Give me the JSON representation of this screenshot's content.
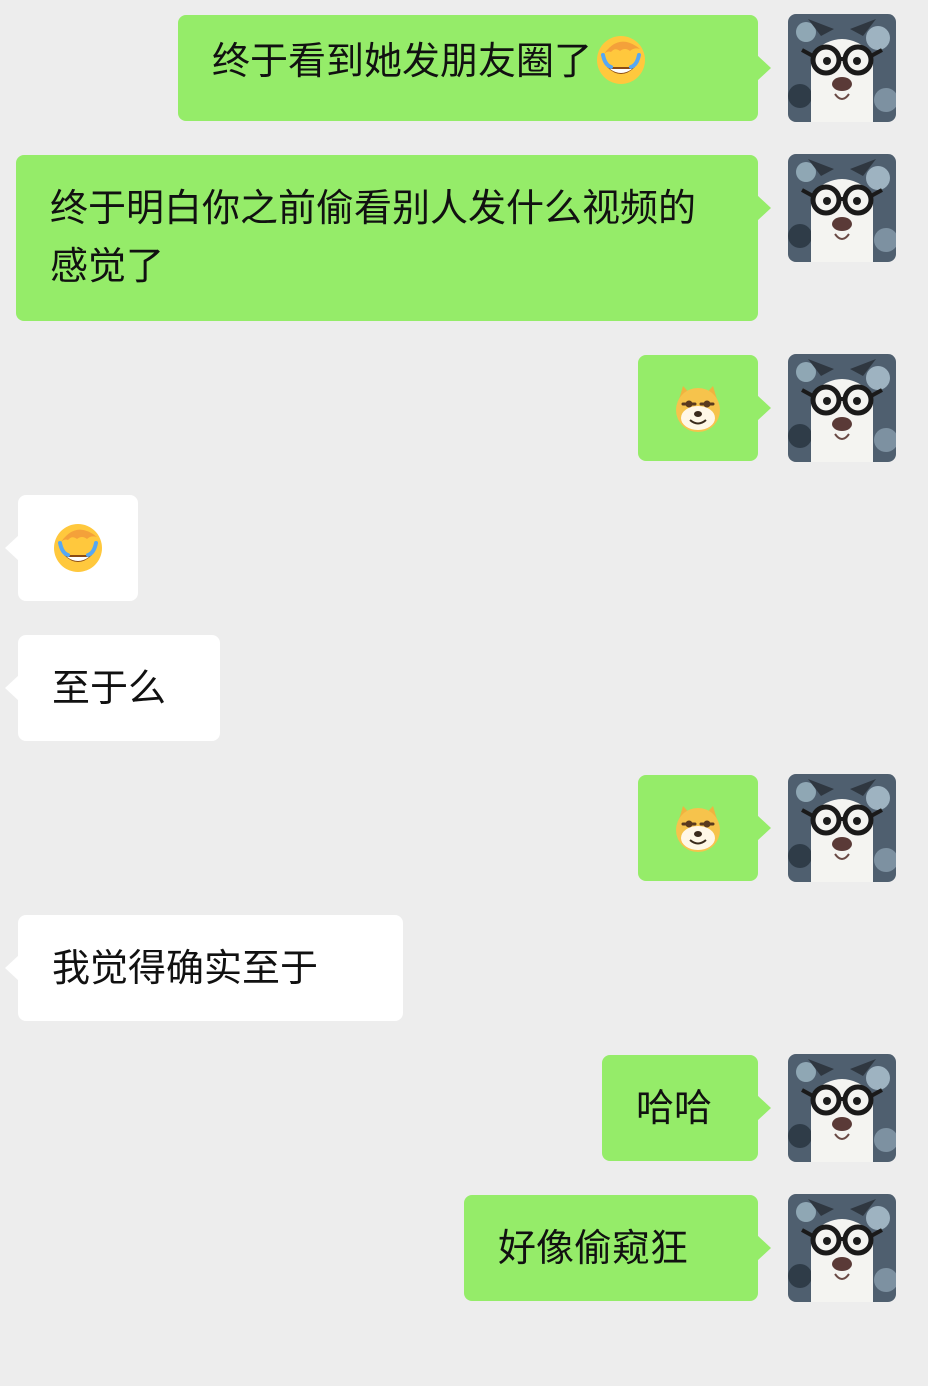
{
  "chat": {
    "messages": [
      {
        "id": "m1",
        "side": "sent",
        "text": "终于看到她发朋友圈了",
        "emoji": "facepalm-laugh-emoji"
      },
      {
        "id": "m2",
        "side": "sent",
        "text": "终于明白你之前偷看别人发什么视频的感觉了"
      },
      {
        "id": "m3",
        "side": "sent",
        "emoji": "doge-emoji"
      },
      {
        "id": "m4",
        "side": "received",
        "emoji": "facepalm-laugh-emoji"
      },
      {
        "id": "m5",
        "side": "received",
        "text": "至于么"
      },
      {
        "id": "m6",
        "side": "sent",
        "emoji": "doge-emoji"
      },
      {
        "id": "m7",
        "side": "received",
        "text": "我觉得确实至于"
      },
      {
        "id": "m8",
        "side": "sent",
        "text": "哈哈"
      },
      {
        "id": "m9",
        "side": "sent",
        "text": "好像偷窥狂"
      }
    ]
  },
  "avatar": {
    "icon": "dog-with-glasses-avatar"
  },
  "colors": {
    "background": "#ededed",
    "sent_bubble": "#95ec69",
    "received_bubble": "#ffffff",
    "text": "#111111"
  }
}
